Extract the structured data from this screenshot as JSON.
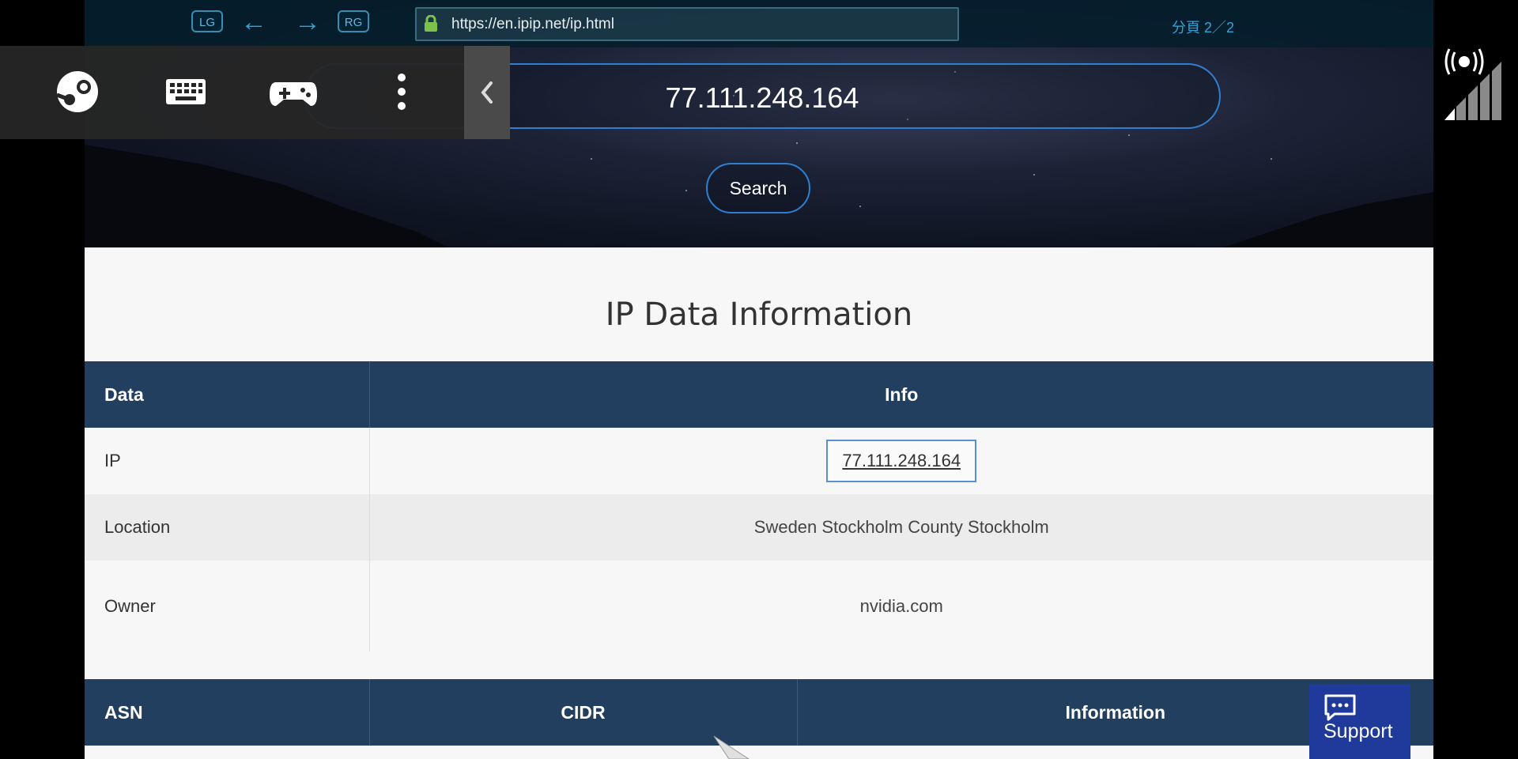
{
  "browser": {
    "left_trigger": "LG",
    "right_trigger": "RG",
    "url": "https://en.ipip.net/ip.html",
    "page_indicator": "分頁 2／2"
  },
  "search": {
    "value": "77.111.248.164",
    "button_label": "Search"
  },
  "section_title": "IP Data Information",
  "ip_table": {
    "headers": [
      "Data",
      "Info"
    ],
    "rows": [
      {
        "label": "IP",
        "value": "77.111.248.164"
      },
      {
        "label": "Location",
        "value": "Sweden Stockholm County Stockholm"
      },
      {
        "label": "Owner",
        "value": "nvidia.com"
      }
    ]
  },
  "asn_table": {
    "headers": [
      "ASN",
      "CIDR",
      "Information"
    ]
  },
  "support": {
    "label": "Support"
  },
  "overlay_icons": [
    "steam-icon",
    "keyboard-icon",
    "gamepad-icon",
    "more-vertical-icon",
    "chevron-left-icon"
  ],
  "colors": {
    "table_header": "#233f5f",
    "accent_blue": "#2f7fd0",
    "support_bg": "#1f3a9a"
  }
}
